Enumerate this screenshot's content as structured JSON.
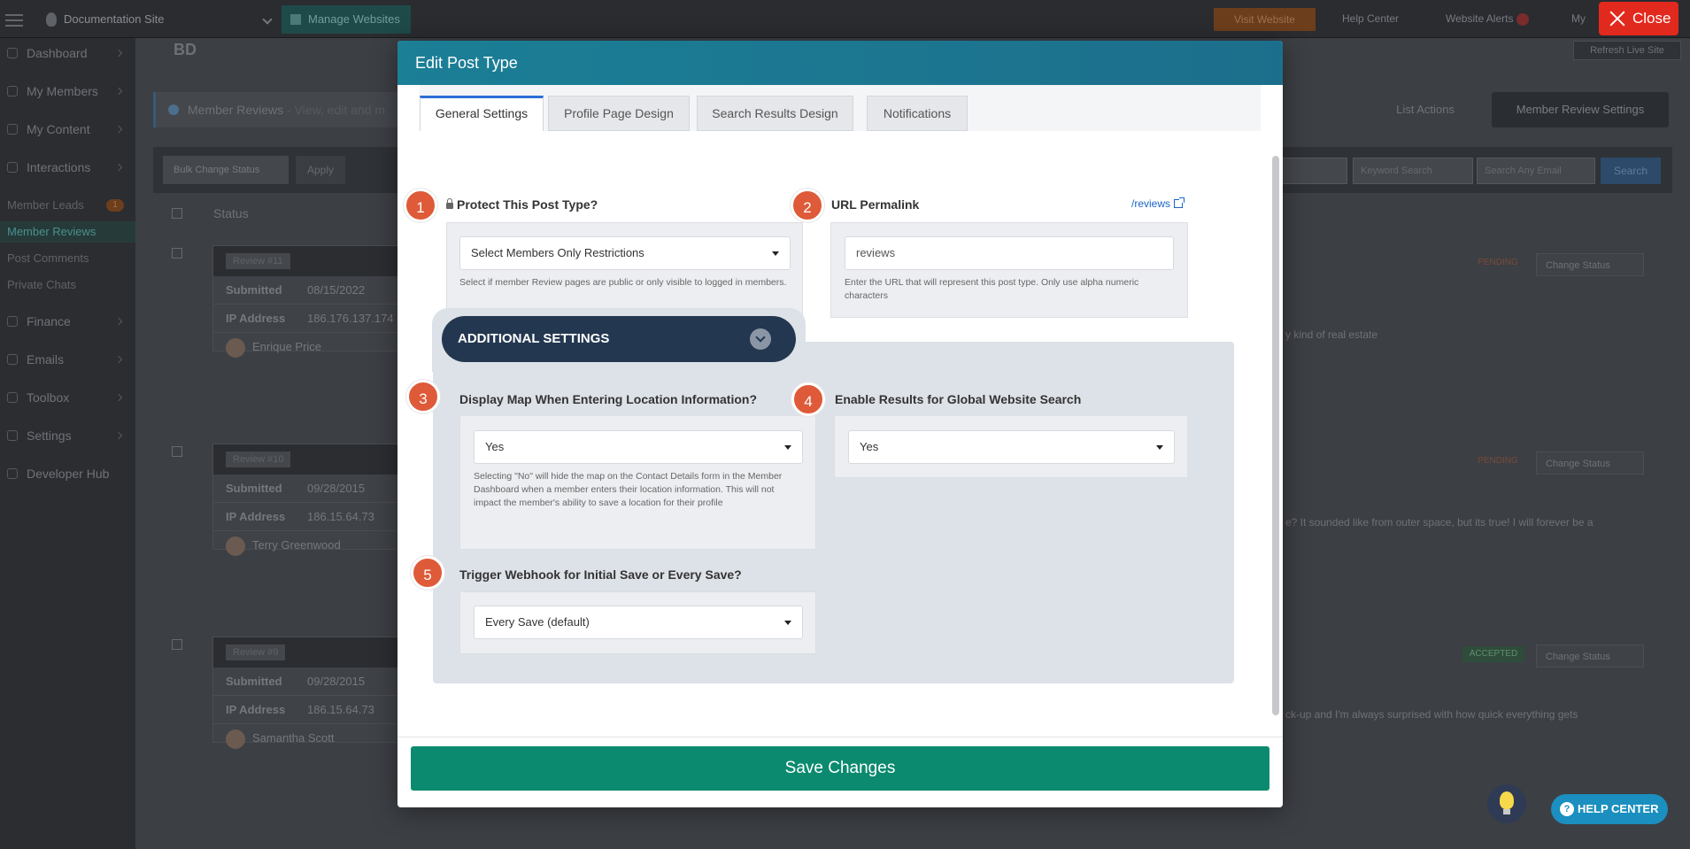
{
  "topbar": {
    "site_name": "Documentation Site",
    "manage_websites": "Manage Websites",
    "visit_website": "Visit Website",
    "help_center": "Help Center",
    "website_alerts": "Website Alerts",
    "my_account": "My",
    "close_label": "Close"
  },
  "sidebar": {
    "items": [
      {
        "label": "Dashboard"
      },
      {
        "label": "My Members"
      },
      {
        "label": "My Content"
      },
      {
        "label": "Interactions"
      }
    ],
    "subitems": [
      {
        "label": "Member Leads",
        "count": "1"
      },
      {
        "label": "Member Reviews"
      },
      {
        "label": "Post Comments"
      },
      {
        "label": "Private Chats"
      }
    ],
    "items2": [
      {
        "label": "Finance"
      },
      {
        "label": "Emails"
      },
      {
        "label": "Toolbox"
      },
      {
        "label": "Settings"
      },
      {
        "label": "Developer Hub"
      }
    ]
  },
  "page": {
    "breadcrumb": "Member Reviews",
    "breadcrumb_desc": "- View, edit and m",
    "refresh_live_site": "Refresh Live Site",
    "list_actions": "List Actions",
    "member_review_settings": "Member Review Settings",
    "bulk_change_status": "Bulk Change Status",
    "apply": "Apply",
    "keyword_search": "Keyword Search",
    "search_any_email": "Search Any Email",
    "search": "Search",
    "status_header": "Status",
    "reviews": [
      {
        "id": "Review #11",
        "submitted": "08/15/2022",
        "ip": "186.176.137.174",
        "user": "Enrique Price",
        "status": "PENDING",
        "snippet": "y kind of real estate"
      },
      {
        "id": "Review #10",
        "submitted": "09/28/2015",
        "ip": "186.15.64.73",
        "user": "Terry Greenwood",
        "status": "PENDING",
        "snippet": "e? It sounded like from outer space, but its true! I will forever be a"
      },
      {
        "id": "Review #9",
        "submitted": "09/28/2015",
        "ip": "186.15.64.73",
        "user": "Samantha Scott",
        "status": "ACCEPTED",
        "snippet": "ck-up and I'm always surprised with how quick everything gets"
      }
    ],
    "submitted_label": "Submitted",
    "ip_label": "IP Address",
    "change_status": "Change Status"
  },
  "modal": {
    "title": "Edit Post Type",
    "tabs": [
      {
        "label": "General Settings"
      },
      {
        "label": "Profile Page Design"
      },
      {
        "label": "Search Results Design"
      },
      {
        "label": "Notifications"
      }
    ],
    "fields": {
      "protect": {
        "number": "1",
        "label": "Protect This Post Type?",
        "value": "Select Members Only Restrictions",
        "hint": "Select if member Review pages are public or only visible to logged in members."
      },
      "permalink": {
        "number": "2",
        "label": "URL Permalink",
        "link": "/reviews",
        "value": "reviews",
        "hint": "Enter the URL that will represent this post type. Only use alpha numeric characters"
      },
      "additional_settings": "ADDITIONAL SETTINGS",
      "display_map": {
        "number": "3",
        "label": "Display Map When Entering Location Information?",
        "value": "Yes",
        "hint": "Selecting \"No\" will hide the map on the Contact Details form in the Member Dashboard when a member enters their location information. This will not impact the member's ability to save a location for their profile"
      },
      "global_search": {
        "number": "4",
        "label": "Enable Results for Global Website Search",
        "value": "Yes"
      },
      "webhook": {
        "number": "5",
        "label": "Trigger Webhook for Initial Save or Every Save?",
        "value": "Every Save (default)"
      }
    },
    "save_label": "Save Changes"
  },
  "help": {
    "help_center": "HELP CENTER"
  },
  "colors": {
    "header": "#1b7f96",
    "accent_step": "#de5a38",
    "save": "#0b8a6f",
    "additional_btn": "#233750",
    "close": "#e2291d"
  }
}
